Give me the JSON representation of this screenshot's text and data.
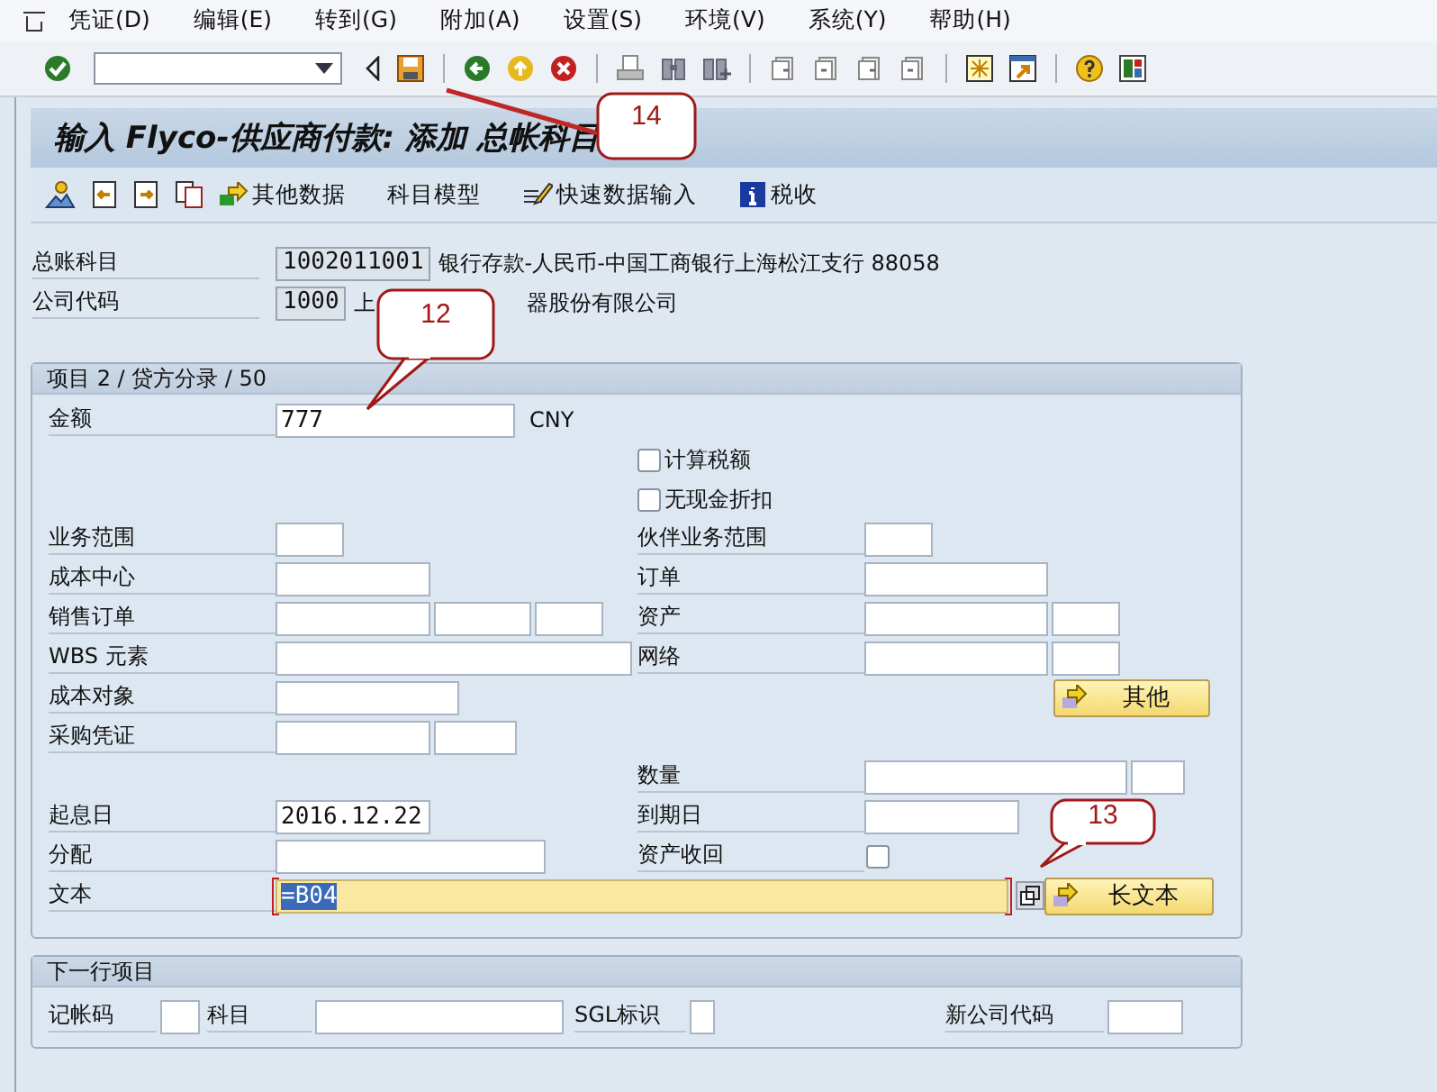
{
  "menu": [
    "凭证(D)",
    "编辑(E)",
    "转到(G)",
    "附加(A)",
    "设置(S)",
    "环境(V)",
    "系统(Y)",
    "帮助(H)"
  ],
  "title": "输入 Flyco-供应商付款: 添加 总帐科目",
  "app_toolbar": [
    {
      "label": "其他数据"
    },
    {
      "label": "科目模型"
    },
    {
      "label": "快速数据输入"
    },
    {
      "label": "税收"
    }
  ],
  "header_fields": [
    {
      "label": "总账科目",
      "value": "1002011001",
      "description_parts": [
        "银行存款-人民币-中国工商银行上海松江支行 88058"
      ]
    },
    {
      "label": "公司代码",
      "value": "1000",
      "description_parts": [
        "上",
        "器股份有限公司"
      ]
    }
  ],
  "item_group": {
    "title": "项目 2 / 贷方分录 / 50",
    "rows": [
      {
        "left": {
          "label": "金额",
          "fields": [
            {
              "kind": "input",
              "value": "777"
            }
          ],
          "unit": "CNY"
        }
      },
      {
        "right": {
          "kind": "checkbox",
          "label": "计算税额",
          "checked": false
        }
      },
      {
        "right": {
          "kind": "checkbox",
          "label": "无现金折扣",
          "checked": false
        }
      },
      {
        "left": {
          "label": "业务范围",
          "fields": [
            {
              "kind": "input"
            }
          ]
        },
        "right": {
          "label": "伙伴业务范围",
          "fields": [
            {
              "kind": "input"
            }
          ]
        }
      },
      {
        "left": {
          "label": "成本中心",
          "fields": [
            {
              "kind": "input"
            }
          ]
        },
        "right": {
          "label": "订单",
          "fields": [
            {
              "kind": "input"
            }
          ]
        }
      },
      {
        "left": {
          "label": "销售订单",
          "fields": [
            {
              "kind": "input"
            },
            {
              "kind": "input"
            },
            {
              "kind": "input"
            }
          ]
        },
        "right": {
          "label": "资产",
          "fields": [
            {
              "kind": "input"
            },
            {
              "kind": "input"
            }
          ]
        }
      },
      {
        "left": {
          "label": "WBS 元素",
          "fields": [
            {
              "kind": "input"
            }
          ]
        },
        "right": {
          "label": "网络",
          "fields": [
            {
              "kind": "input"
            },
            {
              "kind": "input"
            }
          ]
        }
      },
      {
        "left": {
          "label": "成本对象",
          "fields": [
            {
              "kind": "input"
            }
          ]
        },
        "right": {
          "kind": "button",
          "label": "其他"
        }
      },
      {
        "left": {
          "label": "采购凭证",
          "fields": [
            {
              "kind": "input"
            },
            {
              "kind": "input"
            }
          ]
        }
      },
      {
        "right": {
          "label": "数量",
          "fields": [
            {
              "kind": "input"
            },
            {
              "kind": "input"
            }
          ]
        }
      },
      {
        "left": {
          "label": "起息日",
          "fields": [
            {
              "kind": "input",
              "value": "2016.12.22"
            }
          ]
        },
        "right": {
          "label": "到期日",
          "fields": [
            {
              "kind": "input"
            }
          ]
        }
      },
      {
        "left": {
          "label": "分配",
          "fields": [
            {
              "kind": "input"
            }
          ]
        },
        "right": {
          "label": "资产收回",
          "fields": [
            {
              "kind": "checkbox",
              "checked": false
            }
          ]
        }
      },
      {
        "left": {
          "label": "文本",
          "fields": [
            {
              "kind": "input",
              "value": "=B04",
              "focused": true
            }
          ]
        },
        "right": {
          "kind": "button",
          "label": "长文本"
        }
      }
    ]
  },
  "next_line_group": {
    "title": "下一行项目",
    "fields": [
      {
        "label": "记帐码"
      },
      {
        "label": "科目"
      },
      {
        "label": "SGL标识"
      },
      {
        "label": "新公司代码"
      }
    ]
  },
  "callouts": [
    {
      "number": "14"
    },
    {
      "number": "12"
    },
    {
      "number": "13"
    }
  ]
}
